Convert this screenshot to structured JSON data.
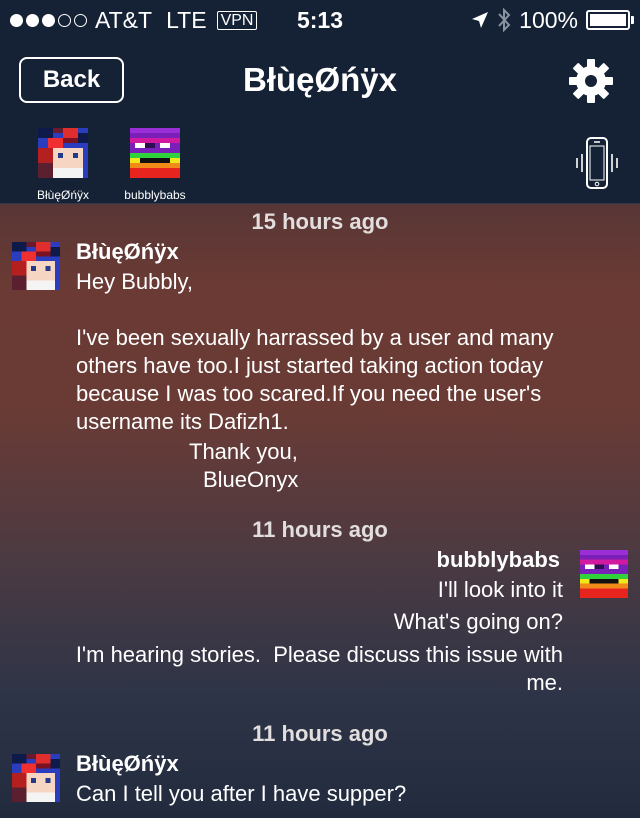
{
  "status_bar": {
    "carrier": "AT&T",
    "network": "LTE",
    "vpn": "VPN",
    "time": "5:13",
    "battery": "100%"
  },
  "nav": {
    "back_label": "Back",
    "title": "BłùęØńÿx"
  },
  "participants": [
    {
      "name": "BłùęØńÿx"
    },
    {
      "name": "bubblybabs"
    }
  ],
  "messages": {
    "ts1": "15 hours ago",
    "m1": {
      "sender": "BłùęØńÿx",
      "lines": [
        "Hey Bubbly,",
        "I've been sexually harrassed by a user and many",
        "others have too.I just started taking action today",
        "because I was too scared.If you need the user's",
        "username its Dafizh1.",
        "Thank you,",
        "BlueOnyx"
      ]
    },
    "ts2": "11 hours ago",
    "m2": {
      "sender": "bubblybabs",
      "lines": [
        "I'll look into it",
        "What's going on?",
        "I'm hearing stories.  Please discuss this issue with",
        "me."
      ]
    },
    "ts3": "11 hours ago",
    "m3": {
      "sender": "BłùęØńÿx",
      "lines": [
        "Can I tell you after I have supper?"
      ]
    }
  },
  "colors": {
    "header_bg": "#152236",
    "text": "#ffffff",
    "timestamp": "#e2dede"
  }
}
